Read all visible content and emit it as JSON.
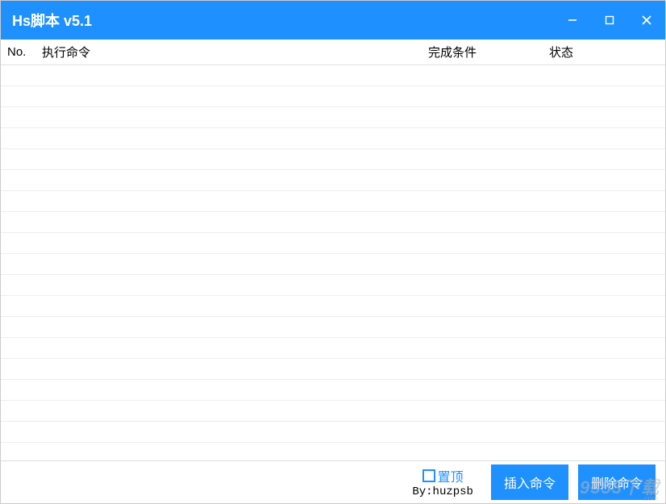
{
  "window": {
    "title": "Hs脚本 v5.1"
  },
  "table": {
    "headers": {
      "no": "No.",
      "command": "执行命令",
      "condition": "完成条件",
      "status": "状态"
    },
    "rows": []
  },
  "footer": {
    "checkbox_label": "置顶",
    "byline": "By:huzpsb",
    "insert_button": "插入命令",
    "delete_button": "删除命令"
  },
  "watermark": {
    "main": "9553下载",
    "sub": ".com"
  }
}
